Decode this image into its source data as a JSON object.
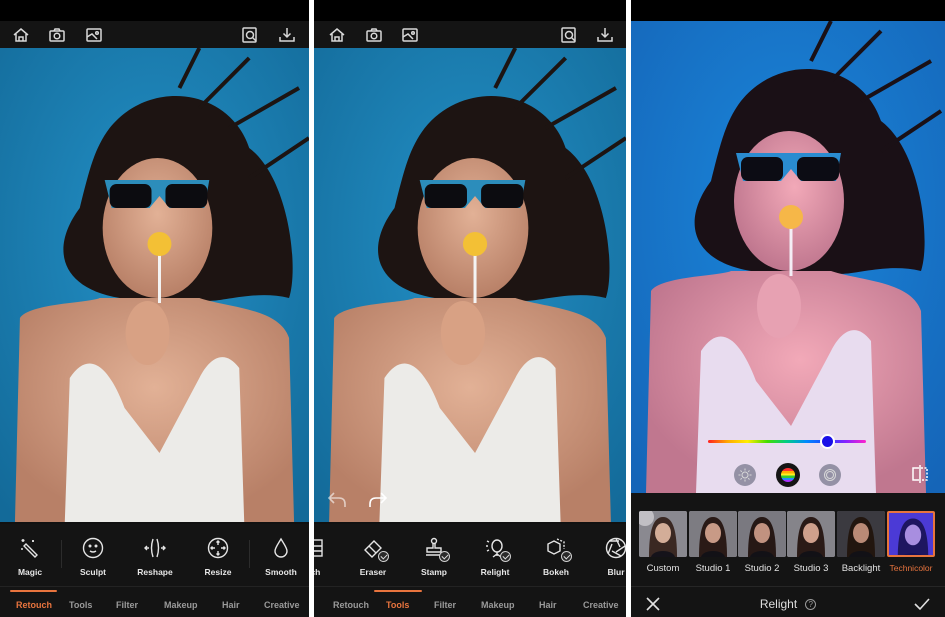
{
  "colors": {
    "accent": "#e8743e",
    "background": "#111111",
    "photo_backdrop": "#1d82b8",
    "hue_thumb": "#1a10e8"
  },
  "topbar": {
    "icons": [
      "home-icon",
      "camera-icon",
      "gallery-icon",
      "zoom-inspect-icon",
      "download-icon"
    ]
  },
  "panel1": {
    "tools": [
      {
        "label": "Magic",
        "icon": "magic-wand-icon"
      },
      {
        "label": "Sculpt",
        "icon": "face-icon"
      },
      {
        "label": "Reshape",
        "icon": "reshape-icon"
      },
      {
        "label": "Resize",
        "icon": "resize-icon"
      },
      {
        "label": "Smooth",
        "icon": "droplet-icon"
      }
    ],
    "tabs": [
      "Retouch",
      "Tools",
      "Filter",
      "Makeup",
      "Hair",
      "Creative"
    ],
    "active_tab": "Retouch"
  },
  "panel2": {
    "tools": [
      {
        "label": "tch",
        "icon": "patch-icon"
      },
      {
        "label": "Eraser",
        "icon": "eraser-icon"
      },
      {
        "label": "Stamp",
        "icon": "stamp-icon"
      },
      {
        "label": "Relight",
        "icon": "relight-icon"
      },
      {
        "label": "Bokeh",
        "icon": "bokeh-icon"
      },
      {
        "label": "Blur",
        "icon": "aperture-icon"
      }
    ],
    "tabs": [
      "Retouch",
      "Tools",
      "Filter",
      "Makeup",
      "Hair",
      "Creative"
    ],
    "active_tab": "Tools"
  },
  "panel3": {
    "hue_slider_fraction": 0.75,
    "light_modes": [
      "brightness",
      "color",
      "ring"
    ],
    "active_mode": "color",
    "presets": [
      {
        "label": "Custom"
      },
      {
        "label": "Studio 1"
      },
      {
        "label": "Studio 2"
      },
      {
        "label": "Studio 3"
      },
      {
        "label": "Backlight"
      },
      {
        "label": "Technicolor"
      }
    ],
    "selected_preset": "Technicolor",
    "footer": {
      "title": "Relight",
      "help": "?"
    }
  }
}
